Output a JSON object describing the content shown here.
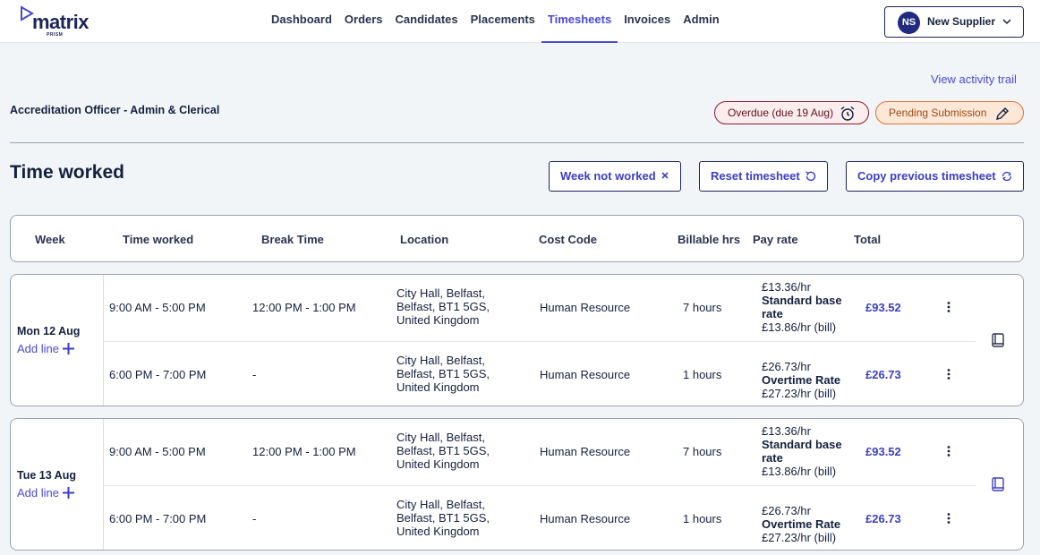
{
  "brand": {
    "name": "matrix",
    "sub": "PRISM"
  },
  "nav": {
    "tabs": [
      {
        "label": "Dashboard",
        "active": false
      },
      {
        "label": "Orders",
        "active": false
      },
      {
        "label": "Candidates",
        "active": false
      },
      {
        "label": "Placements",
        "active": false
      },
      {
        "label": "Timesheets",
        "active": true
      },
      {
        "label": "Invoices",
        "active": false
      },
      {
        "label": "Admin",
        "active": false
      }
    ]
  },
  "user": {
    "initials": "NS",
    "name": "New Supplier"
  },
  "page": {
    "activity_link": "View activity trail",
    "job_title": "Accreditation Officer - Admin & Clerical",
    "badges": {
      "overdue": "Overdue (due 19 Aug)",
      "pending": "Pending Submission"
    },
    "section_title": "Time worked",
    "buttons": {
      "week_not_worked": "Week not worked",
      "reset": "Reset timesheet",
      "copy": "Copy previous timesheet"
    }
  },
  "table": {
    "headers": {
      "week": "Week",
      "time_worked": "Time worked",
      "break_time": "Break Time",
      "location": "Location",
      "cost_code": "Cost Code",
      "billable": "Billable hrs",
      "pay_rate": "Pay rate",
      "total": "Total"
    },
    "add_line_label": "Add line",
    "days": [
      {
        "label": "Mon 12 Aug",
        "rows": [
          {
            "time": "9:00 AM - 5:00 PM",
            "break": "12:00 PM - 1:00 PM",
            "location": [
              "City Hall, Belfast,",
              "Belfast, BT1 5GS,",
              "United Kingdom"
            ],
            "cost_code": "Human Resource",
            "billable": "7 hours",
            "pay_rate": "£13.36/hr",
            "rate_name": "Standard base rate",
            "bill_rate": "£13.86/hr (bill)",
            "total": "£93.52"
          },
          {
            "time": "6:00 PM - 7:00 PM",
            "break": "-",
            "location": [
              "City Hall, Belfast,",
              "Belfast, BT1 5GS,",
              "United Kingdom"
            ],
            "cost_code": "Human Resource",
            "billable": "1 hours",
            "pay_rate": "£26.73/hr",
            "rate_name": "Overtime Rate",
            "bill_rate": "£27.23/hr (bill)",
            "total": "£26.73"
          }
        ]
      },
      {
        "label": "Tue 13 Aug",
        "rows": [
          {
            "time": "9:00 AM - 5:00 PM",
            "break": "12:00 PM - 1:00 PM",
            "location": [
              "City Hall, Belfast,",
              "Belfast, BT1 5GS,",
              "United Kingdom"
            ],
            "cost_code": "Human Resource",
            "billable": "7 hours",
            "pay_rate": "£13.36/hr",
            "rate_name": "Standard base rate",
            "bill_rate": "£13.86/hr (bill)",
            "total": "£93.52"
          },
          {
            "time": "6:00 PM - 7:00 PM",
            "break": "-",
            "location": [
              "City Hall, Belfast,",
              "Belfast, BT1 5GS,",
              "United Kingdom"
            ],
            "cost_code": "Human Resource",
            "billable": "1 hours",
            "pay_rate": "£26.73/hr",
            "rate_name": "Overtime Rate",
            "bill_rate": "£27.23/hr (bill)",
            "total": "£26.73"
          }
        ]
      }
    ]
  },
  "colors": {
    "accent": "#4a4ad8",
    "navy": "#1c2559",
    "overdue": "#8c1d2f",
    "pending": "#d9743a",
    "background": "#f2f5f8"
  },
  "icons": [
    "alarm-clock-icon",
    "pencil-icon",
    "close-icon",
    "reset-icon",
    "copy-refresh-icon",
    "plus-icon",
    "more-vertical-icon",
    "book-icon",
    "chevron-down-icon"
  ]
}
